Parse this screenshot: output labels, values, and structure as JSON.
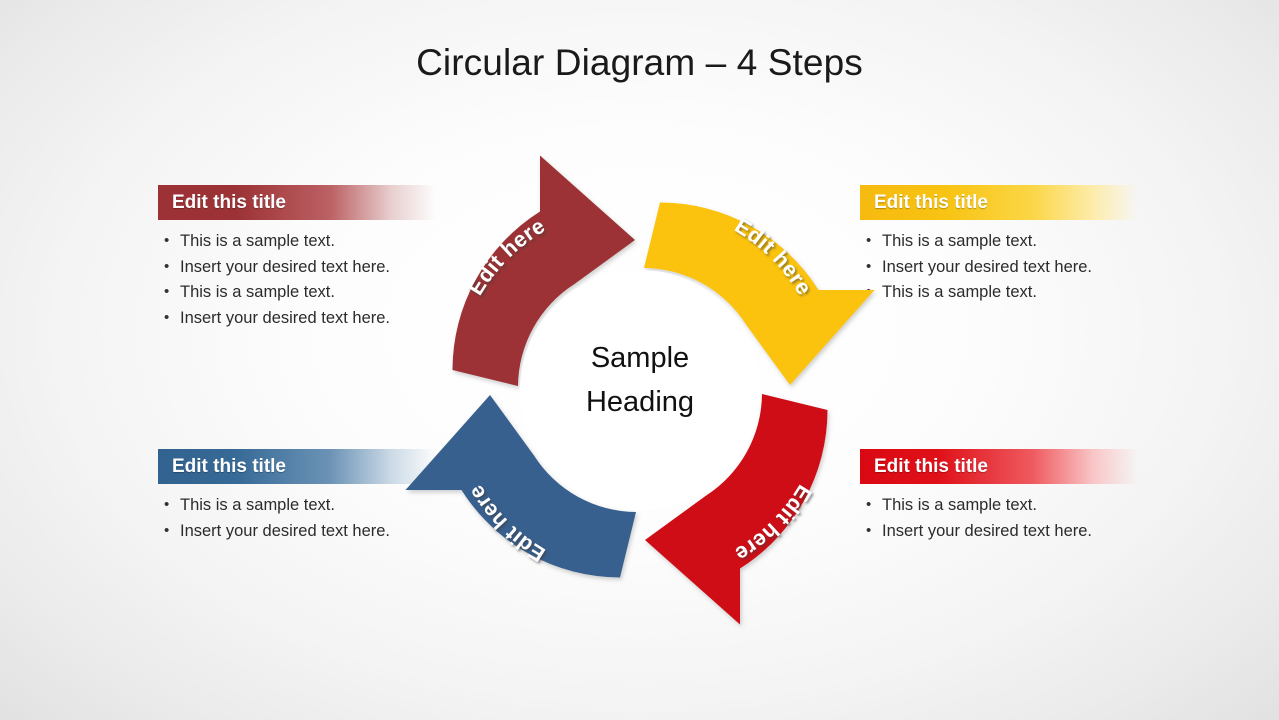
{
  "title": "Circular Diagram – 4 Steps",
  "center": {
    "line1": "Sample",
    "line2": "Heading"
  },
  "colors": {
    "maroon": "#9C3235",
    "amber": "#FBC307",
    "red": "#CE0A14",
    "blue": "#37618E",
    "background_edge": "#DFDFDF",
    "background_center": "#FFFFFF",
    "title_text": "#1A1A1A",
    "body_text": "#2B2B2B",
    "header_text": "#FFFFFF"
  },
  "segments": [
    {
      "id": "top-left",
      "label": "Edit here",
      "color": "#9C3235"
    },
    {
      "id": "top-right",
      "label": "Edit here",
      "color": "#FBC307"
    },
    {
      "id": "bottom-right",
      "label": "Edit here",
      "color": "#CE0A14"
    },
    {
      "id": "bottom-left",
      "label": "Edit here",
      "color": "#37618E"
    }
  ],
  "blocks": {
    "top_left": {
      "header": "Edit this title",
      "bullets": [
        "This is a sample text.",
        "Insert your desired  text here.",
        "This is a sample text.",
        "Insert your desired  text here."
      ]
    },
    "top_right": {
      "header": "Edit this title",
      "bullets": [
        "This is a sample text.",
        "Insert your desired  text here.",
        "This is a sample text."
      ]
    },
    "bottom_left": {
      "header": "Edit this title",
      "bullets": [
        "This is a sample text.",
        "Insert your desired  text here."
      ]
    },
    "bottom_right": {
      "header": "Edit this title",
      "bullets": [
        "This is a sample text.",
        "Insert your desired  text here."
      ]
    }
  }
}
